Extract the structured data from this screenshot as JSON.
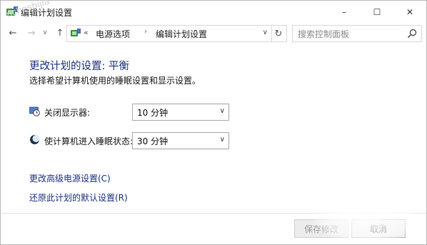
{
  "window": {
    "title": "编辑计划设置",
    "watermark": "ncheshijia",
    "controls": {
      "minimize": "–",
      "maximize": "☐",
      "close": "✕"
    }
  },
  "nav": {
    "back": "←",
    "forward": "→",
    "recent": "∨",
    "up": "↑",
    "address_separator": "«",
    "crumb_1": "电源选项",
    "crumb_arrow": "›",
    "crumb_2": "编辑计划设置",
    "dropdown": "∨",
    "refresh": "↻",
    "search_placeholder": "搜索控制面板"
  },
  "main": {
    "heading": "更改计划的设置: 平衡",
    "subtext": "选择希望计算机使用的睡眠设置和显示设置。",
    "settings": [
      {
        "label": "关闭显示器:",
        "value": "10 分钟",
        "icon": "display-clock-icon"
      },
      {
        "label": "使计算机进入睡眠状态:",
        "value": "30 分钟",
        "icon": "sleep-moon-icon"
      }
    ],
    "links": {
      "advanced": "更改高级电源设置(C)",
      "restore": "还原此计划的默认设置(R)"
    }
  },
  "footer": {
    "save": "保存修改",
    "cancel": "取消"
  },
  "colors": {
    "link": "#1e3287",
    "heading": "#1e3287",
    "border": "#a9a9a9"
  }
}
